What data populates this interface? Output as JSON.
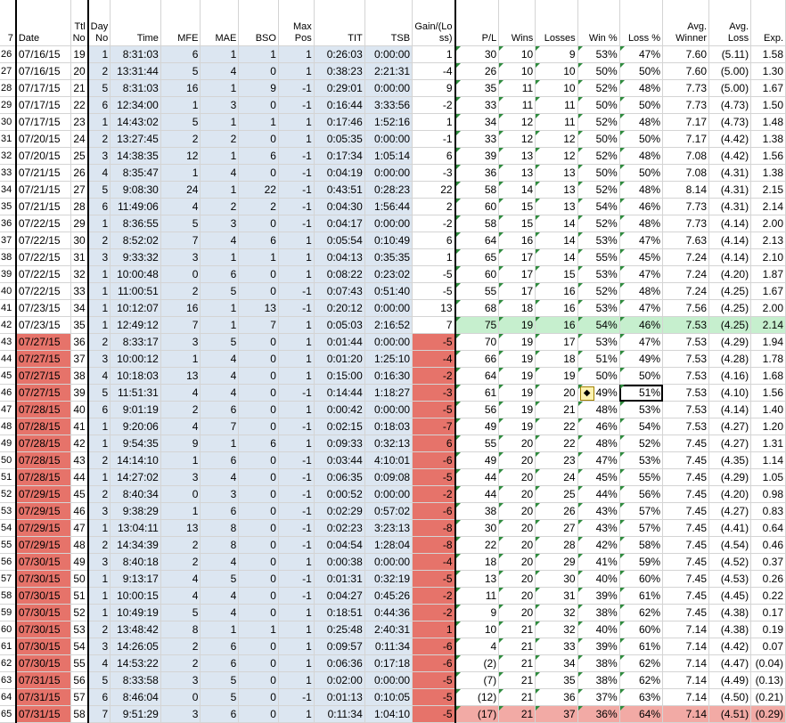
{
  "headers": {
    "row_num": "7",
    "date": "Date",
    "ttl_no": "Ttl No",
    "day_no": "Day No",
    "time": "Time",
    "mfe": "MFE",
    "mae": "MAE",
    "bso": "BSO",
    "max_pos": "Max Pos",
    "tit": "TIT",
    "tsb": "TSB",
    "gain": "Gain/(Loss)",
    "pl": "P/L",
    "wins": "Wins",
    "losses": "Losses",
    "win_pct": "Win %",
    "loss_pct": "Loss %",
    "avg_winner": "Avg. Winner",
    "avg_loss": "Avg. Loss",
    "exp": "Exp."
  },
  "gain_header_lines": [
    "Gain/(Lo",
    "ss)"
  ],
  "rows": [
    [
      "26",
      "07/16/15",
      "19",
      "1",
      "8:31:03",
      "6",
      "1",
      "1",
      "1",
      "0:26:03",
      "0:00:00",
      "1",
      "30",
      "10",
      "9",
      "53%",
      "47%",
      "7.60",
      "(5.11)",
      "1.58"
    ],
    [
      "27",
      "07/16/15",
      "20",
      "2",
      "13:31:44",
      "5",
      "4",
      "0",
      "1",
      "0:38:23",
      "2:21:31",
      "-4",
      "26",
      "10",
      "10",
      "50%",
      "50%",
      "7.60",
      "(5.00)",
      "1.30"
    ],
    [
      "28",
      "07/17/15",
      "21",
      "5",
      "8:31:03",
      "16",
      "1",
      "9",
      "-1",
      "0:29:01",
      "0:00:00",
      "9",
      "35",
      "11",
      "10",
      "52%",
      "48%",
      "7.73",
      "(5.00)",
      "1.67"
    ],
    [
      "29",
      "07/17/15",
      "22",
      "6",
      "12:34:00",
      "1",
      "3",
      "0",
      "-1",
      "0:16:44",
      "3:33:56",
      "-2",
      "33",
      "11",
      "11",
      "50%",
      "50%",
      "7.73",
      "(4.73)",
      "1.50"
    ],
    [
      "30",
      "07/17/15",
      "23",
      "1",
      "14:43:02",
      "5",
      "1",
      "1",
      "1",
      "0:17:46",
      "1:52:16",
      "1",
      "34",
      "12",
      "11",
      "52%",
      "48%",
      "7.17",
      "(4.73)",
      "1.48"
    ],
    [
      "31",
      "07/20/15",
      "24",
      "2",
      "13:27:45",
      "2",
      "2",
      "0",
      "1",
      "0:05:35",
      "0:00:00",
      "-1",
      "33",
      "12",
      "12",
      "50%",
      "50%",
      "7.17",
      "(4.42)",
      "1.38"
    ],
    [
      "32",
      "07/20/15",
      "25",
      "3",
      "14:38:35",
      "12",
      "1",
      "6",
      "-1",
      "0:17:34",
      "1:05:14",
      "6",
      "39",
      "13",
      "12",
      "52%",
      "48%",
      "7.08",
      "(4.42)",
      "1.56"
    ],
    [
      "33",
      "07/21/15",
      "26",
      "4",
      "8:35:47",
      "1",
      "4",
      "0",
      "-1",
      "0:04:19",
      "0:00:00",
      "-3",
      "36",
      "13",
      "13",
      "50%",
      "50%",
      "7.08",
      "(4.31)",
      "1.38"
    ],
    [
      "34",
      "07/21/15",
      "27",
      "5",
      "9:08:30",
      "24",
      "1",
      "22",
      "-1",
      "0:43:51",
      "0:28:23",
      "22",
      "58",
      "14",
      "13",
      "52%",
      "48%",
      "8.14",
      "(4.31)",
      "2.15"
    ],
    [
      "35",
      "07/21/15",
      "28",
      "6",
      "11:49:06",
      "4",
      "2",
      "2",
      "-1",
      "0:04:30",
      "1:56:44",
      "2",
      "60",
      "15",
      "13",
      "54%",
      "46%",
      "7.73",
      "(4.31)",
      "2.14"
    ],
    [
      "36",
      "07/22/15",
      "29",
      "1",
      "8:36:55",
      "5",
      "3",
      "0",
      "-1",
      "0:04:17",
      "0:00:00",
      "-2",
      "58",
      "15",
      "14",
      "52%",
      "48%",
      "7.73",
      "(4.14)",
      "2.00"
    ],
    [
      "37",
      "07/22/15",
      "30",
      "2",
      "8:52:02",
      "7",
      "4",
      "6",
      "1",
      "0:05:54",
      "0:10:49",
      "6",
      "64",
      "16",
      "14",
      "53%",
      "47%",
      "7.63",
      "(4.14)",
      "2.13"
    ],
    [
      "38",
      "07/22/15",
      "31",
      "3",
      "9:33:32",
      "3",
      "1",
      "1",
      "1",
      "0:04:13",
      "0:35:35",
      "1",
      "65",
      "17",
      "14",
      "55%",
      "45%",
      "7.24",
      "(4.14)",
      "2.10"
    ],
    [
      "39",
      "07/22/15",
      "32",
      "1",
      "10:00:48",
      "0",
      "6",
      "0",
      "1",
      "0:08:22",
      "0:23:02",
      "-5",
      "60",
      "17",
      "15",
      "53%",
      "47%",
      "7.24",
      "(4.20)",
      "1.87"
    ],
    [
      "40",
      "07/22/15",
      "33",
      "1",
      "11:00:51",
      "2",
      "5",
      "0",
      "-1",
      "0:07:43",
      "0:51:40",
      "-5",
      "55",
      "17",
      "16",
      "52%",
      "48%",
      "7.24",
      "(4.25)",
      "1.67"
    ],
    [
      "41",
      "07/23/15",
      "34",
      "1",
      "10:12:07",
      "16",
      "1",
      "13",
      "-1",
      "0:20:12",
      "0:00:00",
      "13",
      "68",
      "18",
      "16",
      "53%",
      "47%",
      "7.56",
      "(4.25)",
      "2.00"
    ],
    [
      "42",
      "07/23/15",
      "35",
      "1",
      "12:49:12",
      "7",
      "1",
      "7",
      "1",
      "0:05:03",
      "2:16:52",
      "7",
      "75",
      "19",
      "16",
      "54%",
      "46%",
      "7.53",
      "(4.25)",
      "2.14"
    ],
    [
      "43",
      "07/27/15",
      "36",
      "2",
      "8:33:17",
      "3",
      "5",
      "0",
      "1",
      "0:01:44",
      "0:00:00",
      "-5",
      "70",
      "19",
      "17",
      "53%",
      "47%",
      "7.53",
      "(4.29)",
      "1.94"
    ],
    [
      "44",
      "07/27/15",
      "37",
      "3",
      "10:00:12",
      "1",
      "4",
      "0",
      "1",
      "0:01:20",
      "1:25:10",
      "-4",
      "66",
      "19",
      "18",
      "51%",
      "49%",
      "7.53",
      "(4.28)",
      "1.78"
    ],
    [
      "45",
      "07/27/15",
      "38",
      "4",
      "10:18:03",
      "13",
      "4",
      "0",
      "1",
      "0:15:00",
      "0:16:30",
      "-2",
      "64",
      "19",
      "19",
      "50%",
      "50%",
      "7.53",
      "(4.16)",
      "1.68"
    ],
    [
      "46",
      "07/27/15",
      "39",
      "5",
      "11:51:31",
      "4",
      "4",
      "0",
      "-1",
      "0:14:44",
      "1:18:27",
      "-3",
      "61",
      "19",
      "20",
      "49%",
      "51%",
      "7.53",
      "(4.10)",
      "1.56"
    ],
    [
      "47",
      "07/28/15",
      "40",
      "6",
      "9:01:19",
      "2",
      "6",
      "0",
      "1",
      "0:00:42",
      "0:00:00",
      "-5",
      "56",
      "19",
      "21",
      "48%",
      "53%",
      "7.53",
      "(4.14)",
      "1.40"
    ],
    [
      "48",
      "07/28/15",
      "41",
      "1",
      "9:20:06",
      "4",
      "7",
      "0",
      "-1",
      "0:02:15",
      "0:18:03",
      "-7",
      "49",
      "19",
      "22",
      "46%",
      "54%",
      "7.53",
      "(4.27)",
      "1.20"
    ],
    [
      "49",
      "07/28/15",
      "42",
      "1",
      "9:54:35",
      "9",
      "1",
      "6",
      "1",
      "0:09:33",
      "0:32:13",
      "6",
      "55",
      "20",
      "22",
      "48%",
      "52%",
      "7.45",
      "(4.27)",
      "1.31"
    ],
    [
      "50",
      "07/28/15",
      "43",
      "2",
      "14:14:10",
      "1",
      "6",
      "0",
      "-1",
      "0:03:44",
      "4:10:01",
      "-6",
      "49",
      "20",
      "23",
      "47%",
      "53%",
      "7.45",
      "(4.35)",
      "1.14"
    ],
    [
      "51",
      "07/28/15",
      "44",
      "1",
      "14:27:02",
      "3",
      "4",
      "0",
      "-1",
      "0:06:35",
      "0:09:08",
      "-5",
      "44",
      "20",
      "24",
      "45%",
      "55%",
      "7.45",
      "(4.29)",
      "1.05"
    ],
    [
      "52",
      "07/29/15",
      "45",
      "2",
      "8:40:34",
      "0",
      "3",
      "0",
      "-1",
      "0:00:52",
      "0:00:00",
      "-2",
      "44",
      "20",
      "25",
      "44%",
      "56%",
      "7.45",
      "(4.20)",
      "0.98"
    ],
    [
      "53",
      "07/29/15",
      "46",
      "3",
      "9:38:29",
      "1",
      "6",
      "0",
      "-1",
      "0:02:29",
      "0:57:02",
      "-6",
      "38",
      "20",
      "26",
      "43%",
      "57%",
      "7.45",
      "(4.27)",
      "0.83"
    ],
    [
      "54",
      "07/29/15",
      "47",
      "1",
      "13:04:11",
      "13",
      "8",
      "0",
      "-1",
      "0:02:23",
      "3:23:13",
      "-8",
      "30",
      "20",
      "27",
      "43%",
      "57%",
      "7.45",
      "(4.41)",
      "0.64"
    ],
    [
      "55",
      "07/29/15",
      "48",
      "2",
      "14:34:39",
      "2",
      "8",
      "0",
      "-1",
      "0:04:54",
      "1:28:04",
      "-8",
      "22",
      "20",
      "28",
      "42%",
      "58%",
      "7.45",
      "(4.54)",
      "0.46"
    ],
    [
      "56",
      "07/30/15",
      "49",
      "3",
      "8:40:18",
      "2",
      "4",
      "0",
      "1",
      "0:00:38",
      "0:00:00",
      "-4",
      "18",
      "20",
      "29",
      "41%",
      "59%",
      "7.45",
      "(4.52)",
      "0.37"
    ],
    [
      "57",
      "07/30/15",
      "50",
      "1",
      "9:13:17",
      "4",
      "5",
      "0",
      "-1",
      "0:01:31",
      "0:32:19",
      "-5",
      "13",
      "20",
      "30",
      "40%",
      "60%",
      "7.45",
      "(4.53)",
      "0.26"
    ],
    [
      "58",
      "07/30/15",
      "51",
      "1",
      "10:00:15",
      "4",
      "4",
      "0",
      "-1",
      "0:04:27",
      "0:45:26",
      "-2",
      "11",
      "20",
      "31",
      "39%",
      "61%",
      "7.45",
      "(4.45)",
      "0.22"
    ],
    [
      "59",
      "07/30/15",
      "52",
      "1",
      "10:49:19",
      "5",
      "4",
      "0",
      "1",
      "0:18:51",
      "0:44:36",
      "-2",
      "9",
      "20",
      "32",
      "38%",
      "62%",
      "7.45",
      "(4.38)",
      "0.17"
    ],
    [
      "60",
      "07/30/15",
      "53",
      "2",
      "13:48:42",
      "8",
      "1",
      "1",
      "1",
      "0:25:48",
      "2:40:31",
      "1",
      "10",
      "21",
      "32",
      "40%",
      "60%",
      "7.14",
      "(4.38)",
      "0.19"
    ],
    [
      "61",
      "07/30/15",
      "54",
      "3",
      "14:26:05",
      "2",
      "6",
      "0",
      "1",
      "0:09:57",
      "0:11:34",
      "-6",
      "4",
      "21",
      "33",
      "39%",
      "61%",
      "7.14",
      "(4.42)",
      "0.07"
    ],
    [
      "62",
      "07/30/15",
      "55",
      "4",
      "14:53:22",
      "2",
      "6",
      "0",
      "1",
      "0:06:36",
      "0:17:18",
      "-6",
      "(2)",
      "21",
      "34",
      "38%",
      "62%",
      "7.14",
      "(4.47)",
      "(0.04)"
    ],
    [
      "63",
      "07/31/15",
      "56",
      "5",
      "8:33:58",
      "3",
      "5",
      "0",
      "1",
      "0:02:00",
      "0:00:00",
      "-5",
      "(7)",
      "21",
      "35",
      "38%",
      "62%",
      "7.14",
      "(4.49)",
      "(0.13)"
    ],
    [
      "64",
      "07/31/15",
      "57",
      "6",
      "8:46:04",
      "0",
      "5",
      "0",
      "-1",
      "0:01:13",
      "0:10:05",
      "-5",
      "(12)",
      "21",
      "36",
      "37%",
      "63%",
      "7.14",
      "(4.50)",
      "(0.21)"
    ],
    [
      "65",
      "07/31/15",
      "58",
      "7",
      "9:51:29",
      "3",
      "6",
      "0",
      "1",
      "0:11:34",
      "1:04:10",
      "-5",
      "(17)",
      "21",
      "37",
      "36%",
      "64%",
      "7.14",
      "(4.51)",
      "(0.29)"
    ]
  ],
  "colors": {
    "date_red": "#e6736a",
    "gain_red": "#e6736a",
    "blue_fill": "#dce6f1",
    "highlight_green": "#c6efce",
    "last_row_pink": "#f2aaa5"
  },
  "warning_icon": "warning-diamond-icon"
}
